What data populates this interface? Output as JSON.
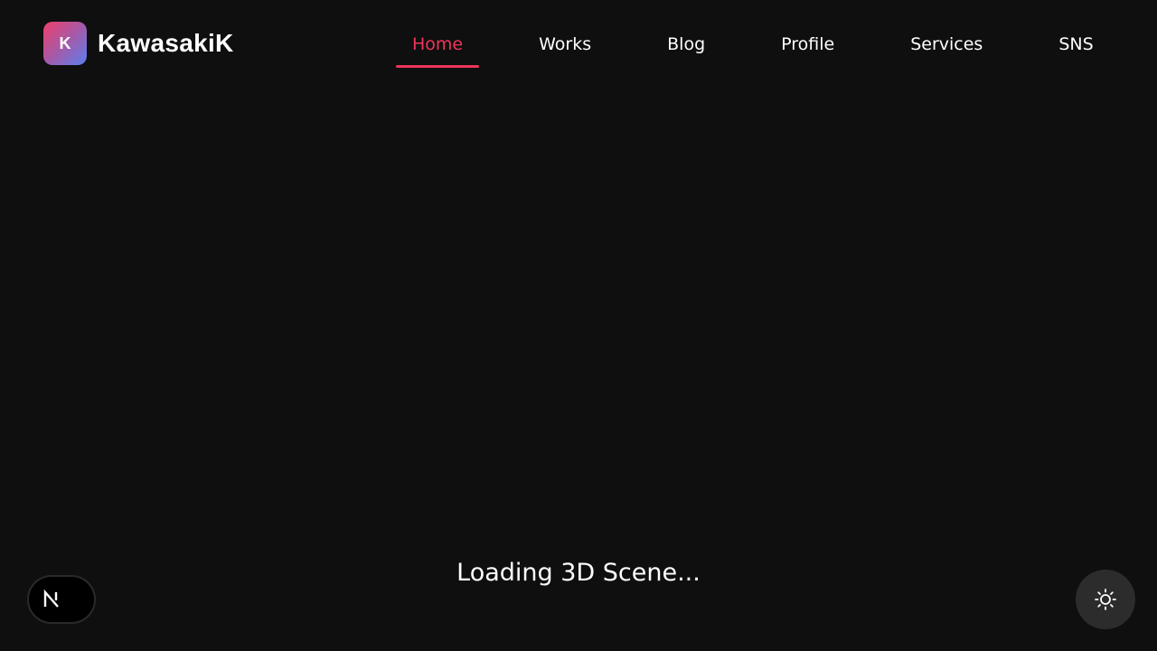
{
  "brand": {
    "logo_letter": "K",
    "name": "KawasakiK"
  },
  "nav": {
    "items": [
      {
        "label": "Home",
        "active": true
      },
      {
        "label": "Works",
        "active": false
      },
      {
        "label": "Blog",
        "active": false
      },
      {
        "label": "Profile",
        "active": false
      },
      {
        "label": "Services",
        "active": false
      },
      {
        "label": "SNS",
        "active": false
      }
    ]
  },
  "main": {
    "loading_text": "Loading 3D Scene..."
  },
  "icons": {
    "next_badge": "nextjs-logo-icon",
    "theme_toggle": "sun-icon"
  },
  "colors": {
    "background": "#0f0f0f",
    "accent": "#ee3559",
    "logo_gradient_start": "#ee3f6a",
    "logo_gradient_end": "#5a7ff0"
  }
}
